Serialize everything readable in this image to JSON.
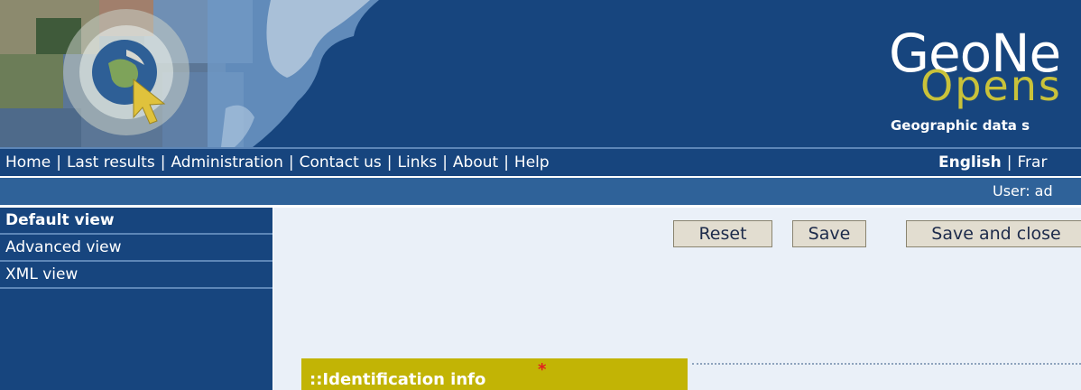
{
  "banner": {
    "logo_text": "GeoNe",
    "logo_sub": "Opens",
    "tagline": "Geographic data s"
  },
  "nav": {
    "items": [
      "Home",
      "Last results",
      "Administration",
      "Contact us",
      "Links",
      "About",
      "Help"
    ],
    "separator": "|",
    "languages": [
      "English",
      "Frar"
    ]
  },
  "userbar": {
    "user_text": "User: ad"
  },
  "sidebar": {
    "items": [
      {
        "label": "Default view",
        "active": true
      },
      {
        "label": "Advanced view",
        "active": false
      },
      {
        "label": "XML view",
        "active": false
      }
    ]
  },
  "toolbar": {
    "reset_label": "Reset",
    "save_label": "Save",
    "save_close_label": "Save and close"
  },
  "section": {
    "title": "::Identification info",
    "required_marker": "*"
  },
  "colors": {
    "banner": "#17457e",
    "userbar": "#2f6299",
    "content_bg": "#eaf0f8",
    "section_header": "#c2b405",
    "required": "#e0211f",
    "button_bg": "#e2ddd0"
  }
}
